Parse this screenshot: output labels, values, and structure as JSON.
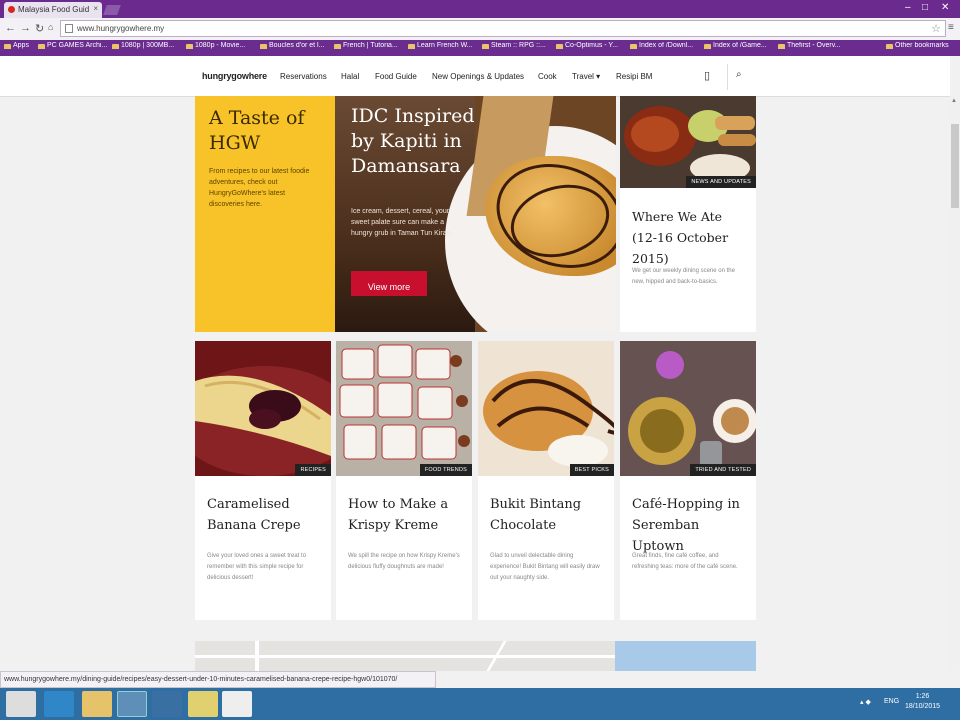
{
  "browser": {
    "tab_title": "Malaysia Food Guid",
    "url": "www.hungrygowhere.my",
    "status_url": "www.hungrygowhere.my/dining-guide/recipes/easy-dessert-under-10-minutes-caramelised-banana-crepe-recipe-hgw0/101070/"
  },
  "bookmarks": [
    {
      "label": "Apps"
    },
    {
      "label": "PC GAMES Archi..."
    },
    {
      "label": "1080p | 300MB..."
    },
    {
      "label": "1080p - Movie..."
    },
    {
      "label": "Boucles d'or et l..."
    },
    {
      "label": "French | Tutoria..."
    },
    {
      "label": "Learn French W..."
    },
    {
      "label": "Steam :: RPG ::..."
    },
    {
      "label": "Co-Optimus - Y..."
    },
    {
      "label": "Index of /Downl..."
    },
    {
      "label": "Index of /Game..."
    },
    {
      "label": "Thefirst - Overv..."
    },
    {
      "label": "Other bookmarks"
    }
  ],
  "site": {
    "logo": "hungrygowhere",
    "nav": [
      "Reservations",
      "Halal",
      "Food Guide",
      "New Openings & Updates",
      "Cook",
      "Travel ▾",
      "Resipi BM"
    ]
  },
  "promo": {
    "title": "A Taste of HGW",
    "text": "From recipes to our latest foodie adventures, check out HungryGoWhere's latest discoveries here."
  },
  "hero": {
    "title": "IDC Inspired by Kapiti in Damansara",
    "text": "Ice cream, dessert, cereal, your sweet palate sure can make a hungry grub in Taman Tun Kiran.",
    "button": "View more"
  },
  "side_card": {
    "tag": "NEWS AND UPDATES",
    "title": "Where We Ate (12-16 October 2015)",
    "text": "We get our weekly dining scene on the new, hipped and back-to-basics."
  },
  "cards": [
    {
      "tag": "RECIPES",
      "title": "Caramelised Banana Crepe",
      "text": "Give your loved ones a sweet treat to remember with this simple recipe for delicious dessert!"
    },
    {
      "tag": "FOOD TRENDS",
      "title": "How to Make a Krispy Kreme",
      "text": "We spill the recipe on how Krispy Kreme's delicious fluffy doughnuts are made!"
    },
    {
      "tag": "BEST PICKS",
      "title": "Bukit Bintang Chocolate",
      "text": "Glad to unveil delectable dining experience! Bukit Bintang will easily draw out your naughty side."
    },
    {
      "tag": "TRIED AND TESTED",
      "title": "Café-Hopping in Seremban Uptown",
      "text": "Great finds, fine café coffee, and refreshing teas: more of the café scene."
    }
  ],
  "taskbar": {
    "lang": "ENG",
    "time": "1:26",
    "date": "18/10/2015"
  }
}
